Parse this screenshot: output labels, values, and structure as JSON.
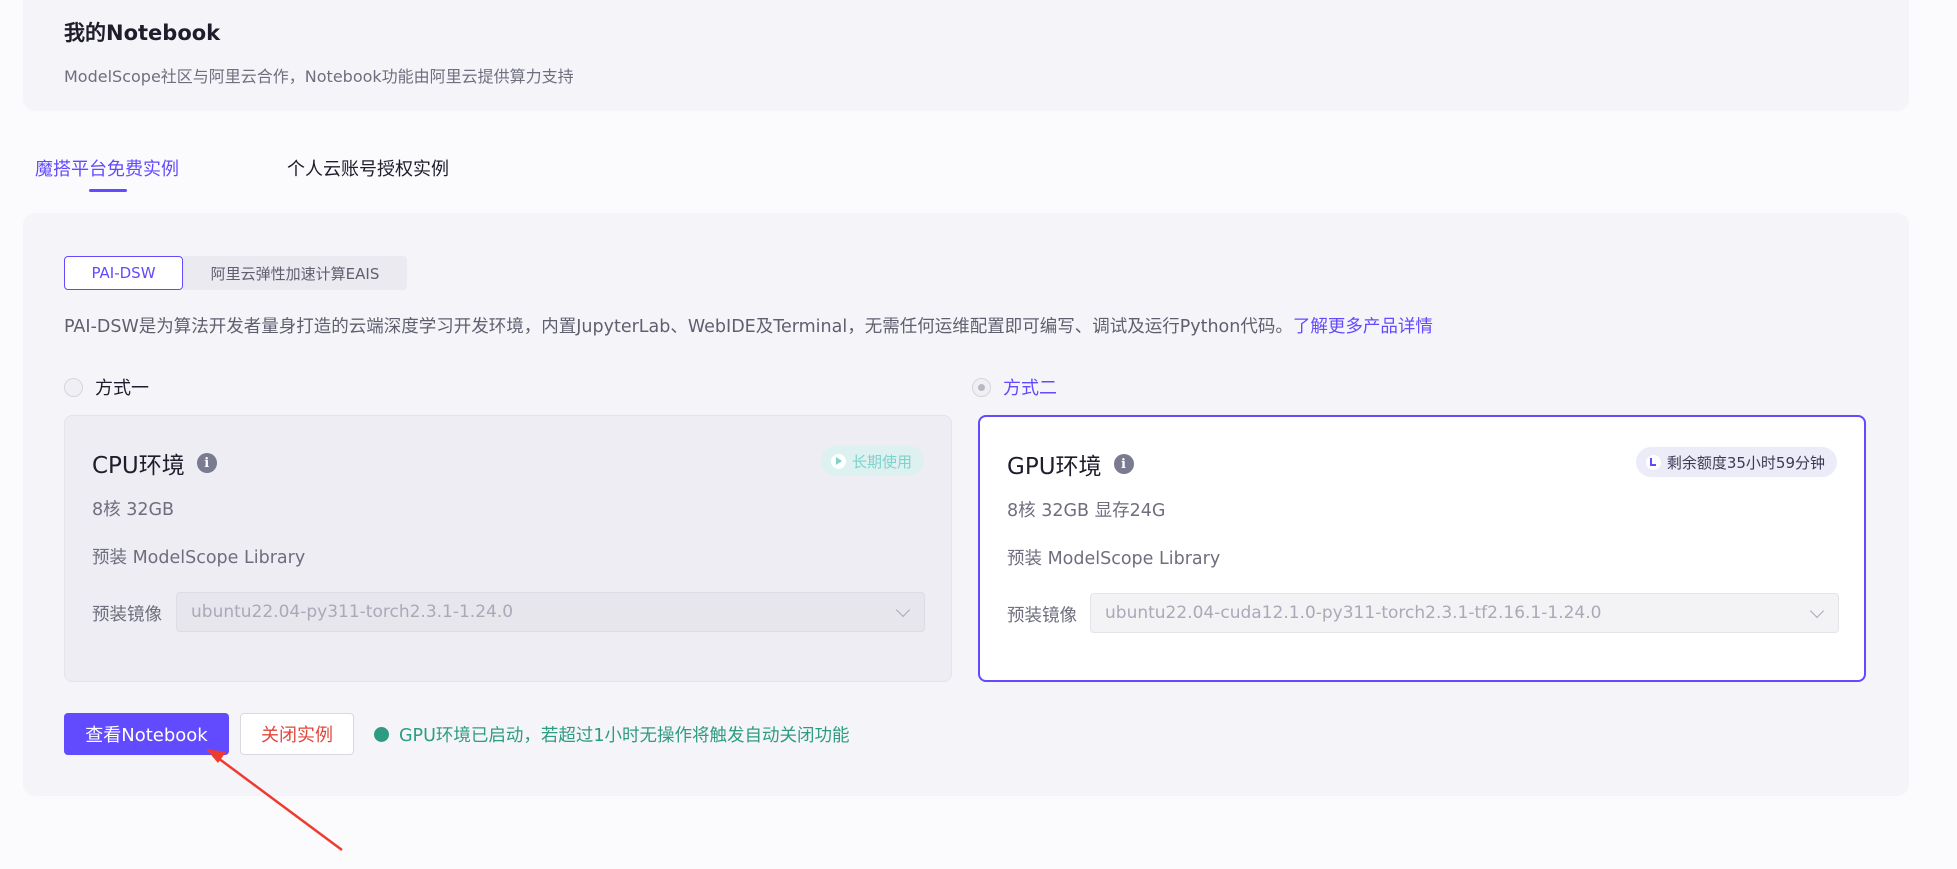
{
  "header": {
    "title": "我的Notebook",
    "subtitle": "ModelScope社区与阿里云合作，Notebook功能由阿里云提供算力支持"
  },
  "tabs": [
    {
      "label": "魔搭平台免费实例",
      "active": true
    },
    {
      "label": "个人云账号授权实例",
      "active": false
    }
  ],
  "segments": [
    {
      "label": "PAI-DSW",
      "active": true
    },
    {
      "label": "阿里云弹性加速计算EAIS",
      "active": false
    }
  ],
  "description": {
    "text": "PAI-DSW是为算法开发者量身打造的云端深度学习开发环境，内置JupyterLab、WebIDE及Terminal，无需任何运维配置即可编写、调试及运行Python代码。",
    "link": "了解更多产品详情"
  },
  "options": [
    {
      "label": "方式一",
      "checked": false
    },
    {
      "label": "方式二",
      "checked": true
    }
  ],
  "cpu_card": {
    "title": "CPU环境",
    "badge": "长期使用",
    "spec": "8核 32GB",
    "library": "预装 ModelScope Library",
    "image_label": "预装镜像",
    "image_value": "ubuntu22.04-py311-torch2.3.1-1.24.0"
  },
  "gpu_card": {
    "title": "GPU环境",
    "badge": "剩余额度35小时59分钟",
    "spec": "8核 32GB 显存24G",
    "library": "预装 ModelScope Library",
    "image_label": "预装镜像",
    "image_value": "ubuntu22.04-cuda12.1.0-py311-torch2.3.1-tf2.16.1-1.24.0"
  },
  "actions": {
    "view_notebook": "查看Notebook",
    "close_instance": "关闭实例",
    "status": "GPU环境已启动，若超过1小时无操作将触发自动关闭功能"
  },
  "colors": {
    "accent": "#624aff",
    "danger": "#e0463a",
    "success": "#2e9c80",
    "annotation_arrow": "#ee3b30"
  }
}
